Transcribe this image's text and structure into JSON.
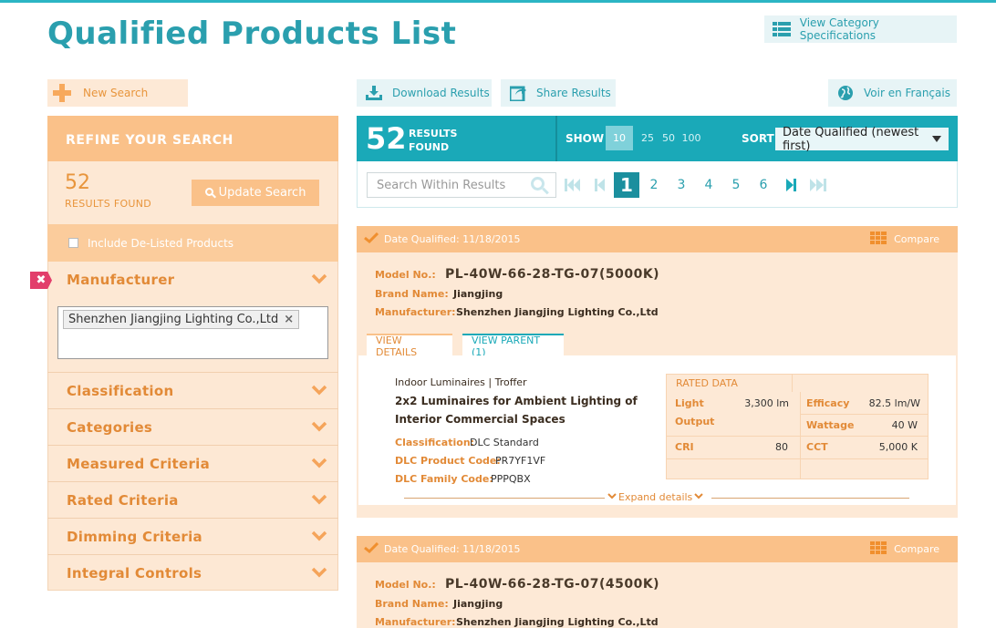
{
  "page": {
    "title": "Qualified Products List"
  },
  "header": {
    "view_spec_label": "View Category Specifications",
    "voir_label": "Voir en Français"
  },
  "toolbar": {
    "new_search": "New Search",
    "download": "Download Results",
    "share": "Share Results"
  },
  "refine": {
    "title": "REFINE YOUR SEARCH",
    "count": "52",
    "count_label": "RESULTS FOUND",
    "update_label": "Update Search",
    "delisted_label": "Include De-Listed Products",
    "manufacturer_label": "Manufacturer",
    "manufacturer_tag": "Shenzhen Jiangjing Lighting Co.,Ltd",
    "facets": [
      "Classification",
      "Categories",
      "Measured Criteria",
      "Rated Criteria",
      "Dimming Criteria",
      "Integral Controls"
    ]
  },
  "results": {
    "count": "52",
    "label1": "RESULTS",
    "label2": "FOUND",
    "show_label": "SHOW",
    "per_page": [
      "10",
      "25",
      "50",
      "100"
    ],
    "per_page_selected": "10",
    "sort_label": "SORT",
    "sort_value": "Date Qualified (newest first)",
    "search_placeholder": "Search Within Results",
    "pages": [
      "1",
      "2",
      "3",
      "4",
      "5",
      "6"
    ],
    "current_page": "1"
  },
  "labels": {
    "model": "Model No.:",
    "brand": "Brand Name:",
    "manufacturer": "Manufacturer:",
    "compare": "Compare",
    "view_details": "VIEW DETAILS",
    "view_parent": "VIEW PARENT (1)",
    "classification": "Classification:",
    "product_code": "DLC Product Code:",
    "family_code": "DLC Family Code:",
    "rated_data": "RATED DATA",
    "light": "Light",
    "output": "Output",
    "efficacy": "Efficacy",
    "wattage": "Wattage",
    "cri": "CRI",
    "cct": "CCT",
    "expand": "Expand details"
  },
  "products": [
    {
      "date": "Date Qualified: 11/18/2015",
      "model": "PL-40W-66-28-TG-07(5000K)",
      "brand": "Jiangjing",
      "manufacturer": "Shenzhen Jiangjing Lighting Co.,Ltd",
      "category": "Indoor Luminaires | Troffer",
      "name_line1": "2x2 Luminaires for Ambient Lighting of",
      "name_line2": "Interior Commercial Spaces",
      "classification": "DLC Standard",
      "product_code": "PR7YF1VF",
      "family_code": "PPPQBX",
      "light_output": "3,300 lm",
      "efficacy": "82.5 lm/W",
      "wattage": "40 W",
      "cri": "80",
      "cct": "5,000 K"
    },
    {
      "date": "Date Qualified: 11/18/2015",
      "model": "PL-40W-66-28-TG-07(4500K)",
      "brand": "Jiangjing",
      "manufacturer": "Shenzhen Jiangjing Lighting Co.,Ltd"
    }
  ],
  "colors": {
    "teal": "#1aa9b8",
    "orange": "#fac189",
    "orange_text": "#e28a37",
    "pale_orange": "#fde9d6"
  }
}
